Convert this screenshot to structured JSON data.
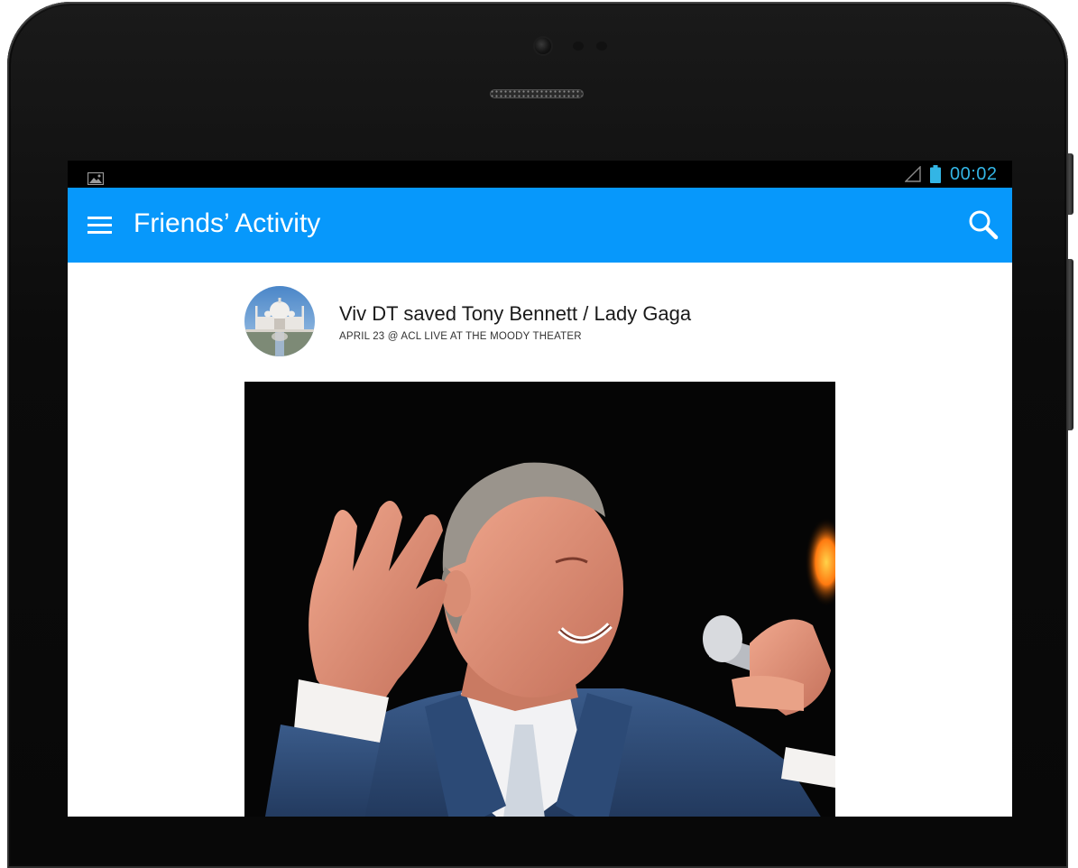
{
  "status_bar": {
    "time": "00:02",
    "time_color": "#33b5e5",
    "icons": [
      "gallery-icon",
      "signal-icon",
      "battery-icon"
    ]
  },
  "app_bar": {
    "title": "Friends’ Activity",
    "background_color": "#0798fb",
    "menu_icon": "menu-icon",
    "search_icon": "search-icon"
  },
  "feed": {
    "items": [
      {
        "avatar": "avatar-taj-mahal",
        "title": "Viv DT saved Tony Bennett / Lady Gaga",
        "subtitle": "APRIL 23 @ ACL LIVE AT THE MOODY THEATER",
        "photo": "concert-photo"
      }
    ]
  }
}
